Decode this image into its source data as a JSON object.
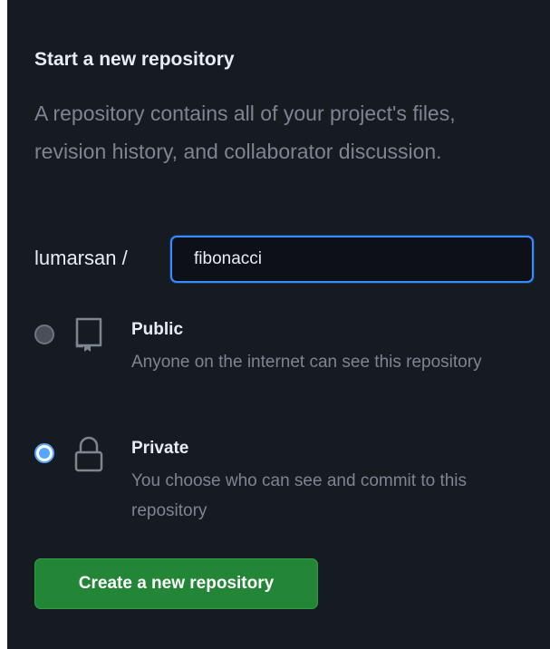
{
  "panel": {
    "title": "Start a new repository",
    "description": "A repository contains all of your project's files, revision history, and collaborator discussion."
  },
  "repo": {
    "owner": "lumarsan /",
    "name_value": "fibonacci"
  },
  "visibility": {
    "selected": "private",
    "options": [
      {
        "id": "public",
        "label": "Public",
        "description": "Anyone on the internet can see this repository",
        "icon": "repo-icon"
      },
      {
        "id": "private",
        "label": "Private",
        "description": "You choose who can see and commit to this repository",
        "icon": "lock-icon"
      }
    ]
  },
  "actions": {
    "create_label": "Create a new repository"
  },
  "colors": {
    "background": "#161b22",
    "accent": "#388bfd",
    "button": "#238636",
    "muted_text": "#7d8590"
  }
}
